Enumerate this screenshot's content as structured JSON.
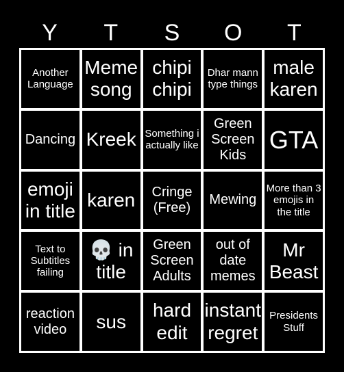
{
  "header": [
    "Y",
    "T",
    "S",
    "O",
    "T"
  ],
  "cells": [
    {
      "text": "Another Language",
      "size": "s"
    },
    {
      "text": "Meme song",
      "size": "l"
    },
    {
      "text": "chipi chipi",
      "size": "l"
    },
    {
      "text": "Dhar mann type things",
      "size": "s"
    },
    {
      "text": "male karen",
      "size": "l"
    },
    {
      "text": "Dancing",
      "size": "m"
    },
    {
      "text": "Kreek",
      "size": "l"
    },
    {
      "text": "Something i actually like",
      "size": "s"
    },
    {
      "text": "Green Screen Kids",
      "size": "m"
    },
    {
      "text": "GTA",
      "size": "xl"
    },
    {
      "text": "emoji in title",
      "size": "l"
    },
    {
      "text": "karen",
      "size": "l"
    },
    {
      "text": "Cringe (Free)",
      "size": "m"
    },
    {
      "text": "Mewing",
      "size": "m"
    },
    {
      "text": "More than 3 emojis in the title",
      "size": "s"
    },
    {
      "text": "Text to Subtitles failing",
      "size": "s"
    },
    {
      "text": "💀 in title",
      "size": "l"
    },
    {
      "text": "Green Screen Adults",
      "size": "m"
    },
    {
      "text": "out of date memes",
      "size": "m"
    },
    {
      "text": "Mr Beast",
      "size": "l"
    },
    {
      "text": "reaction video",
      "size": "m"
    },
    {
      "text": "sus",
      "size": "l"
    },
    {
      "text": "hard edit",
      "size": "l"
    },
    {
      "text": "instant regret",
      "size": "l"
    },
    {
      "text": "Presidents Stuff",
      "size": "s"
    }
  ]
}
